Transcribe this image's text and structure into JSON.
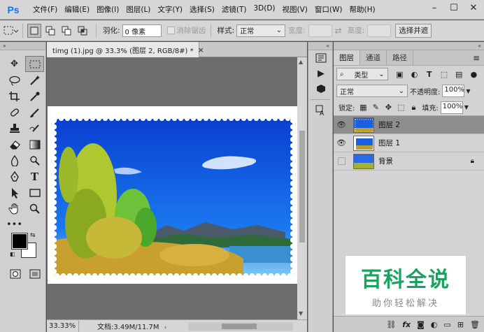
{
  "app": {
    "logo": "Ps"
  },
  "menu": [
    "文件(F)",
    "编辑(E)",
    "图像(I)",
    "图层(L)",
    "文字(Y)",
    "选择(S)",
    "滤镜(T)",
    "3D(D)",
    "视图(V)",
    "窗口(W)",
    "帮助(H)"
  ],
  "window_controls": [
    "–",
    "☐",
    "✕"
  ],
  "options": {
    "feather_label": "羽化:",
    "feather_value": "0 像素",
    "antialias_label": "消除锯齿",
    "style_label": "样式:",
    "style_value": "正常",
    "width_label": "宽度:",
    "height_label": "高度:",
    "select_mask_button": "选择并遮"
  },
  "document": {
    "tab_title": "timg (1).jpg @ 33.3% (图层 2, RGB/8#) *",
    "tab_close": "×",
    "zoom": "33.33%",
    "doc_info": "文档:3.49M/11.7M",
    "status_arrow": "›"
  },
  "layers_panel": {
    "tabs": [
      "图层",
      "通道",
      "路径"
    ],
    "menu_icon": "≡",
    "filter_kind": "类型",
    "blend_mode": "正常",
    "opacity_label": "不透明度:",
    "opacity_value": "100%",
    "lock_label": "锁定:",
    "fill_label": "填充:",
    "fill_value": "100%",
    "layers": [
      {
        "name": "图层 2",
        "visible": true,
        "selected": true,
        "locked": false
      },
      {
        "name": "图层 1",
        "visible": true,
        "selected": false,
        "locked": false
      },
      {
        "name": "背景",
        "visible": false,
        "selected": false,
        "locked": true
      }
    ],
    "bottom_icons": [
      "link-icon",
      "fx-icon",
      "mask-icon",
      "adjustment-icon",
      "group-icon",
      "new-layer-icon",
      "trash-icon"
    ]
  },
  "watermark": {
    "main": "百科全说",
    "sub": "助你轻松解决"
  },
  "colors": {
    "foreground": "#000000",
    "background": "#ffffff",
    "accent": "#1aa260",
    "ps_blue": "#1473e6"
  }
}
